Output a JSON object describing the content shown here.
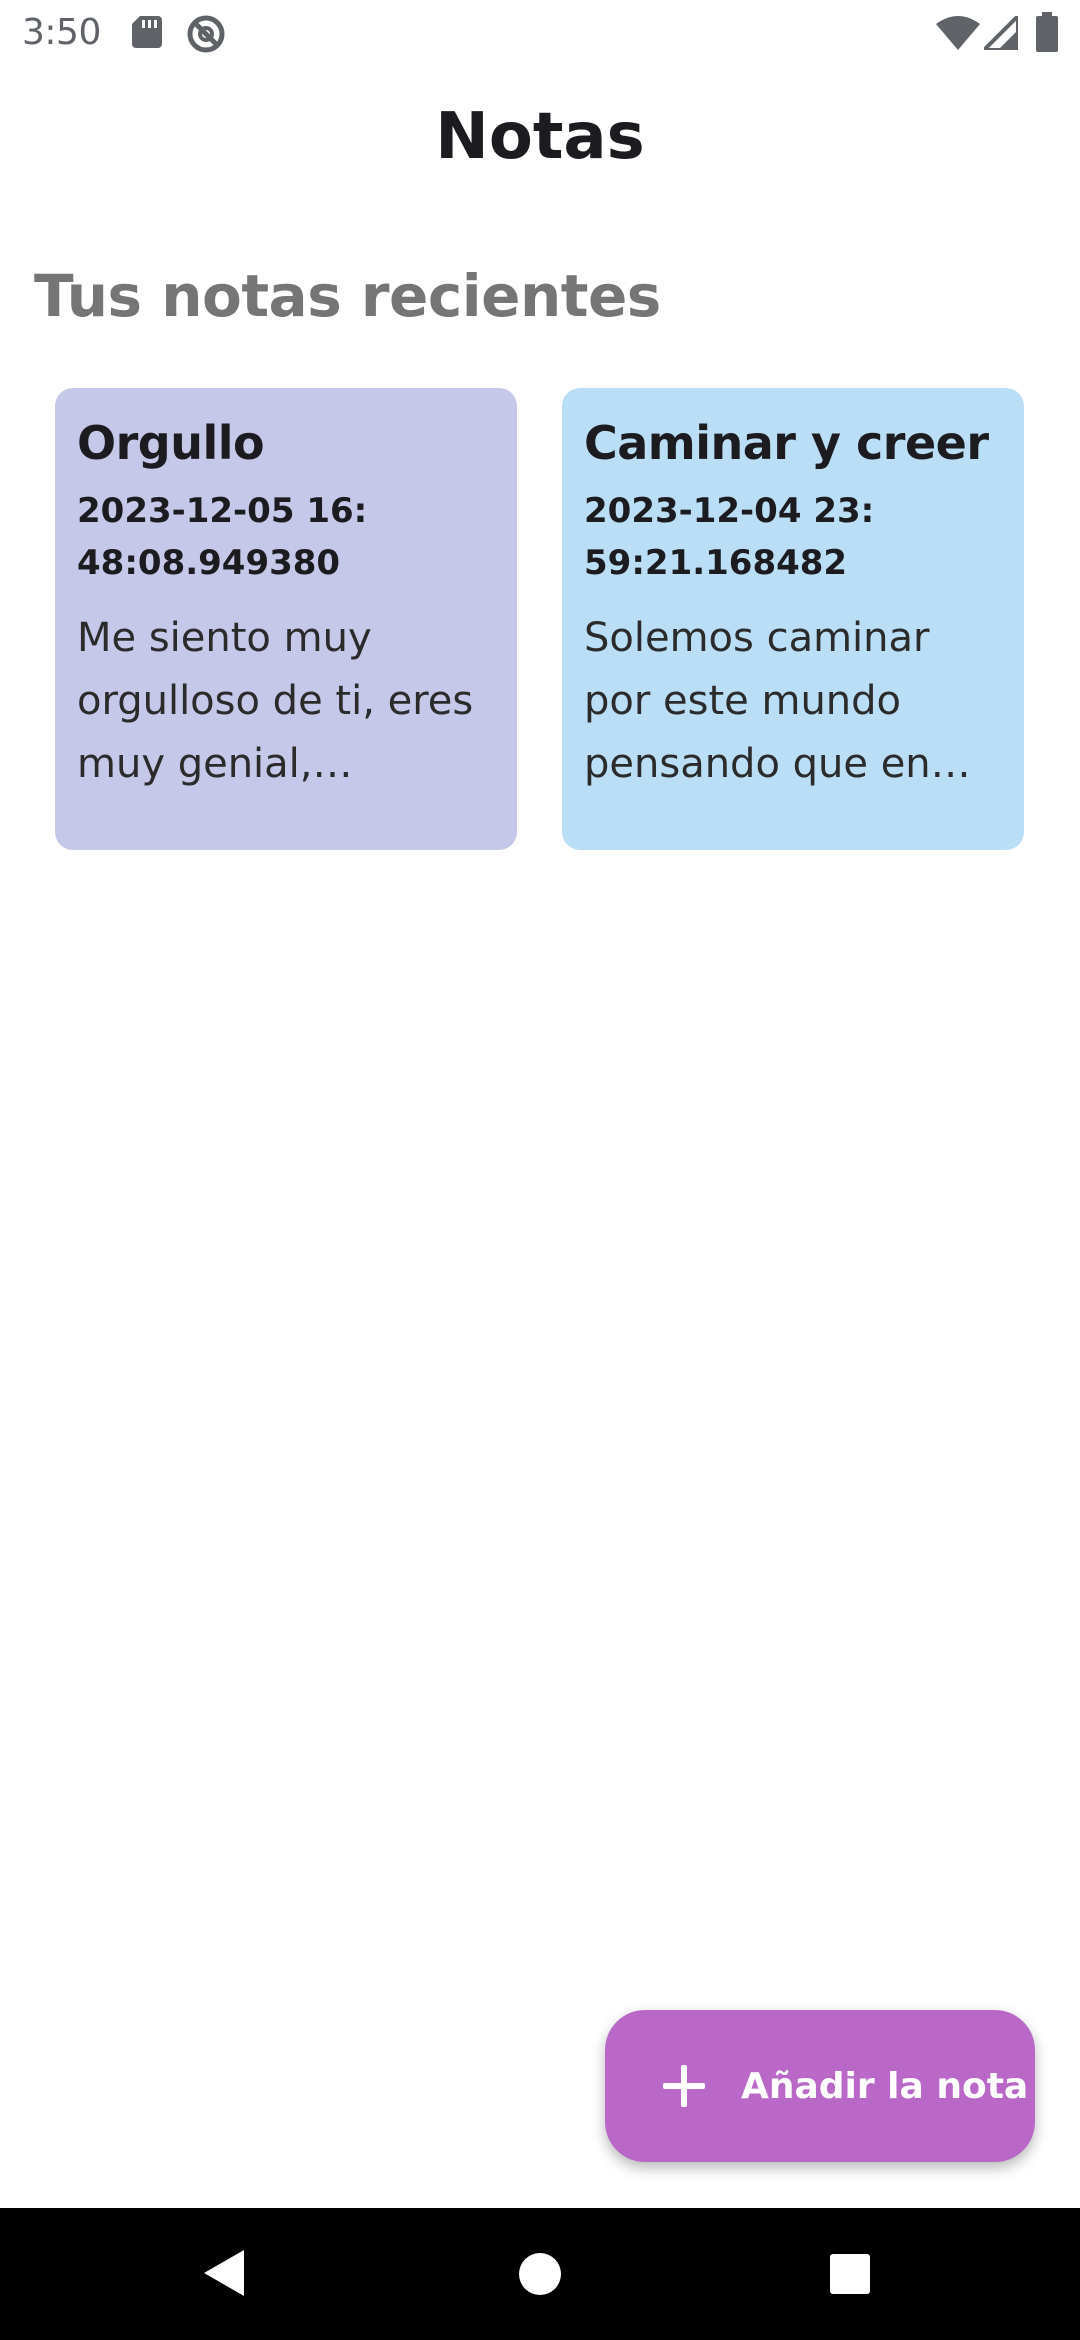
{
  "status_bar": {
    "time": "3:50",
    "icons_left": [
      "sd-card-icon",
      "no-disturb-icon"
    ],
    "icons_right": [
      "wifi-icon",
      "cellular-signal-icon",
      "battery-icon"
    ]
  },
  "header": {
    "title": "Notas"
  },
  "section": {
    "title": "Tus notas recientes"
  },
  "notes": [
    {
      "title": "Orgullo",
      "date": "2023-12-05 16:48:08.949380",
      "body": "Me siento muy orgulloso de ti, eres muy genial, inteligente",
      "color": "#c5c8e8"
    },
    {
      "title": "Caminar y creer",
      "date": "2023-12-04 23:59:21.168482",
      "body": "Solemos caminar por este mundo pensando que en algún momento",
      "color": "#bbdef7"
    }
  ],
  "fab": {
    "label": "Añadir la nota",
    "icon": "plus-icon",
    "color": "#ba68c8"
  },
  "navigation_bar": {
    "buttons": [
      "back-icon",
      "home-icon",
      "recents-icon"
    ]
  }
}
